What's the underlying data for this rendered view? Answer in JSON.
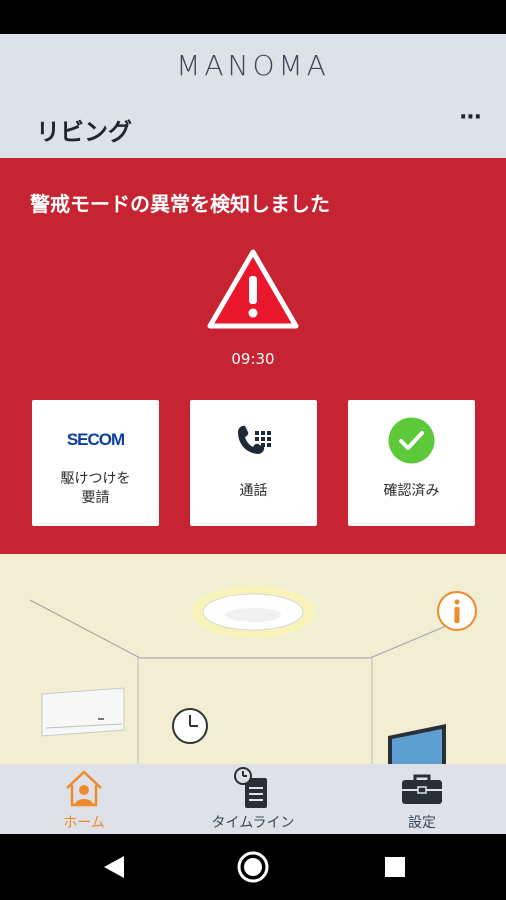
{
  "app": {
    "brand": "MANOMA"
  },
  "room": {
    "title": "リビング",
    "more_label": "···"
  },
  "alert": {
    "message": "警戒モードの異常を検知しました",
    "time": "09:30",
    "colors": {
      "background": "#c72433",
      "icon": "#e8172b"
    },
    "actions": [
      {
        "icon": "secom-logo",
        "logo_text": "SECOM",
        "label_line1": "駆けつけを",
        "label_line2": "要請"
      },
      {
        "icon": "phone-icon",
        "label": "通話"
      },
      {
        "icon": "check-icon",
        "label": "確認済み",
        "color": "#5cc83a"
      }
    ]
  },
  "nav": {
    "items": [
      {
        "label": "ホーム",
        "icon": "home-icon",
        "active": true,
        "color": "#ee8a2a"
      },
      {
        "label": "タイムライン",
        "icon": "timeline-icon",
        "active": false
      },
      {
        "label": "設定",
        "icon": "toolbox-icon",
        "active": false
      }
    ]
  }
}
